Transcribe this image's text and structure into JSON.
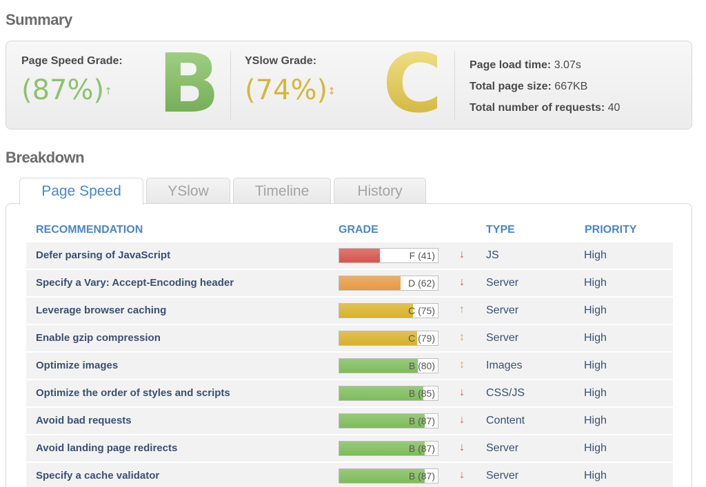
{
  "summary": {
    "title": "Summary",
    "pagespeed": {
      "label": "Page Speed Grade:",
      "percent": "(87%)",
      "trend": "↑",
      "trend_color": "#8dc26f",
      "letter": "B"
    },
    "yslow": {
      "label": "YSlow Grade:",
      "percent": "(74%)",
      "trend": "↕",
      "trend_color": "#e1a84a",
      "letter": "C"
    },
    "stats": [
      {
        "label": "Page load time:",
        "value": "3.07s"
      },
      {
        "label": "Total page size:",
        "value": "667KB"
      },
      {
        "label": "Total number of requests:",
        "value": "40"
      }
    ]
  },
  "breakdown": {
    "title": "Breakdown",
    "tabs": [
      "Page Speed",
      "YSlow",
      "Timeline",
      "History"
    ],
    "active_tab": "Page Speed",
    "columns": [
      "RECOMMENDATION",
      "GRADE",
      "TYPE",
      "PRIORITY"
    ],
    "rows": [
      {
        "recommendation": "Defer parsing of JavaScript",
        "grade": "F (41)",
        "score": 41,
        "color": "#d9534f",
        "arrow": "↓",
        "arrow_color": "#e0533d",
        "type": "JS",
        "priority": "High"
      },
      {
        "recommendation": "Specify a Vary: Accept-Encoding header",
        "grade": "D (62)",
        "score": 62,
        "color": "#e69a45",
        "arrow": "↓",
        "arrow_color": "#e0533d",
        "type": "Server",
        "priority": "High"
      },
      {
        "recommendation": "Leverage browser caching",
        "grade": "C (75)",
        "score": 75,
        "color": "#d8b12a",
        "arrow": "↑",
        "arrow_color": "#7cbf5c",
        "type": "Server",
        "priority": "High"
      },
      {
        "recommendation": "Enable gzip compression",
        "grade": "C (79)",
        "score": 79,
        "color": "#d8b12a",
        "arrow": "↕",
        "arrow_color": "#e1a84a",
        "type": "Server",
        "priority": "High"
      },
      {
        "recommendation": "Optimize images",
        "grade": "B (80)",
        "score": 80,
        "color": "#7ebc5a",
        "arrow": "↕",
        "arrow_color": "#e1a84a",
        "type": "Images",
        "priority": "High"
      },
      {
        "recommendation": "Optimize the order of styles and scripts",
        "grade": "B (85)",
        "score": 85,
        "color": "#7ebc5a",
        "arrow": "↓",
        "arrow_color": "#e0533d",
        "type": "CSS/JS",
        "priority": "High"
      },
      {
        "recommendation": "Avoid bad requests",
        "grade": "B (87)",
        "score": 87,
        "color": "#7ebc5a",
        "arrow": "↓",
        "arrow_color": "#e0533d",
        "type": "Content",
        "priority": "High"
      },
      {
        "recommendation": "Avoid landing page redirects",
        "grade": "B (87)",
        "score": 87,
        "color": "#7ebc5a",
        "arrow": "↓",
        "arrow_color": "#e0533d",
        "type": "Server",
        "priority": "High"
      },
      {
        "recommendation": "Specify a cache validator",
        "grade": "B (87)",
        "score": 87,
        "color": "#7ebc5a",
        "arrow": "↓",
        "arrow_color": "#e0533d",
        "type": "Server",
        "priority": "High"
      }
    ]
  }
}
